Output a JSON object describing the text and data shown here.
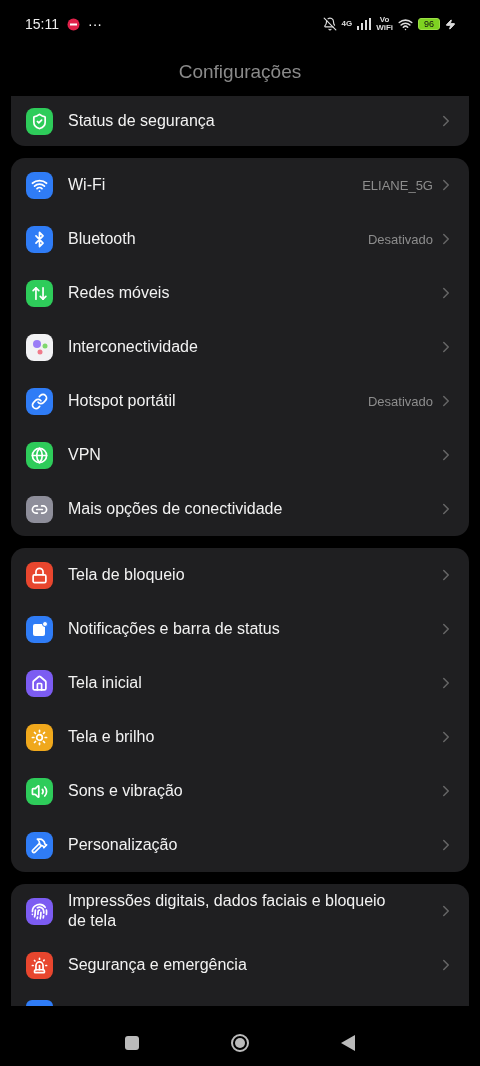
{
  "status_bar": {
    "time": "15:11",
    "more": "···",
    "network": "4G",
    "volte_top": "Vo",
    "volte_bottom": "WiFi",
    "battery": "96",
    "charging": true
  },
  "header": {
    "title": "Configurações"
  },
  "groups": [
    {
      "items": [
        {
          "kind": "shield",
          "color": "#2ecc5a",
          "label": "Status de segurança"
        }
      ]
    },
    {
      "items": [
        {
          "kind": "wifi",
          "color": "#2f7cf6",
          "label": "Wi-Fi",
          "value": "ELIANE_5G"
        },
        {
          "kind": "bluetooth",
          "color": "#2f7cf6",
          "label": "Bluetooth",
          "value": "Desativado"
        },
        {
          "kind": "mobile",
          "color": "#2ecc5a",
          "label": "Redes móveis"
        },
        {
          "kind": "dots",
          "color": "#f2f2f4",
          "label": "Interconectividade"
        },
        {
          "kind": "hotspot",
          "color": "#2f7cf6",
          "label": "Hotspot portátil",
          "value": "Desativado"
        },
        {
          "kind": "globe",
          "color": "#2ecc5a",
          "label": "VPN"
        },
        {
          "kind": "link",
          "color": "#8e8e9a",
          "label": "Mais opções de conectividade"
        }
      ]
    },
    {
      "items": [
        {
          "kind": "lock",
          "color": "#e8462e",
          "label": "Tela de bloqueio"
        },
        {
          "kind": "notify",
          "color": "#2f7cf6",
          "label": "Notificações e barra de status"
        },
        {
          "kind": "home",
          "color": "#7c5cf2",
          "label": "Tela inicial"
        },
        {
          "kind": "sun",
          "color": "#f0a81c",
          "label": "Tela e brilho"
        },
        {
          "kind": "sound",
          "color": "#2ecc5a",
          "label": "Sons e vibração"
        },
        {
          "kind": "brush",
          "color": "#2f7cf6",
          "label": "Personalização"
        }
      ]
    },
    {
      "items": [
        {
          "kind": "fingerprint",
          "color": "#7c5cf2",
          "label": "Impressões digitais, dados faciais e bloqueio de tela"
        },
        {
          "kind": "siren",
          "color": "#e8462e",
          "label": "Segurança e emergência"
        }
      ]
    }
  ]
}
